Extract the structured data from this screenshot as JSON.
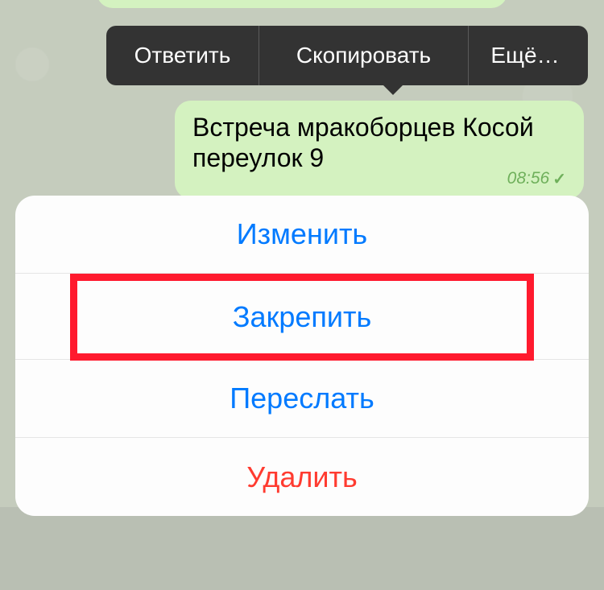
{
  "context_bar": {
    "reply": "Ответить",
    "copy": "Скопировать",
    "more": "Ещё…"
  },
  "message": {
    "text": "Встреча мракоборцев Косой переулок 9",
    "time": "08:56"
  },
  "actions": {
    "edit": "Изменить",
    "pin": "Закрепить",
    "forward": "Переслать",
    "delete": "Удалить"
  }
}
